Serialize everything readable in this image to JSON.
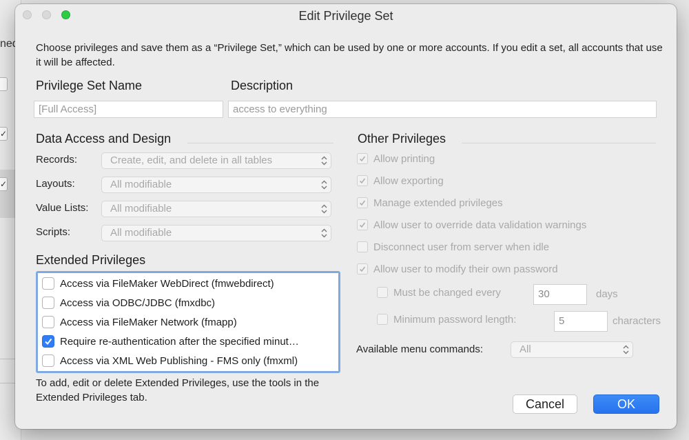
{
  "background": {
    "partial_text": "ned",
    "check_glyph": "✓"
  },
  "dialog": {
    "title": "Edit Privilege Set",
    "intro": "Choose privileges and save them as a “Privilege Set,” which can be used by one or more accounts. If you edit a set, all accounts that use it will be affected.",
    "name_label": "Privilege Set Name",
    "name_value": "[Full Access]",
    "description_label": "Description",
    "description_value": "access to everything"
  },
  "data_access": {
    "heading": "Data Access and Design",
    "rows": [
      {
        "label": "Records:",
        "value": "Create, edit, and delete in all tables"
      },
      {
        "label": "Layouts:",
        "value": "All modifiable"
      },
      {
        "label": "Value Lists:",
        "value": "All modifiable"
      },
      {
        "label": "Scripts:",
        "value": "All modifiable"
      }
    ]
  },
  "extended": {
    "heading": "Extended Privileges",
    "items": [
      {
        "label": "Access via FileMaker WebDirect (fmwebdirect)",
        "checked": false
      },
      {
        "label": "Access via ODBC/JDBC (fmxdbc)",
        "checked": false
      },
      {
        "label": "Access via FileMaker Network (fmapp)",
        "checked": false
      },
      {
        "label": "Require re-authentication after the specified minut…",
        "checked": true
      },
      {
        "label": "Access via XML Web Publishing - FMS only (fmxml)",
        "checked": false
      }
    ],
    "help": "To add, edit or delete Extended Privileges, use the tools in the Extended Privileges tab."
  },
  "other": {
    "heading": "Other Privileges",
    "items": [
      {
        "label": "Allow printing",
        "checked": true
      },
      {
        "label": "Allow exporting",
        "checked": true
      },
      {
        "label": "Manage extended privileges",
        "checked": true
      },
      {
        "label": "Allow user to override data validation warnings",
        "checked": true
      },
      {
        "label": "Disconnect user from server when idle",
        "checked": false
      },
      {
        "label": "Allow user to modify their own password",
        "checked": true
      }
    ],
    "must_change_label": "Must be changed every",
    "must_change_value": "30",
    "must_change_unit": "days",
    "min_length_label": "Minimum password length:",
    "min_length_value": "5",
    "min_length_unit": "characters",
    "menu_label": "Available menu commands:",
    "menu_value": "All"
  },
  "buttons": {
    "cancel": "Cancel",
    "ok": "OK"
  },
  "colors": {
    "accent": "#2f7ef5",
    "focus_ring": "#7fa9e0",
    "zoom_button": "#2ecb44"
  }
}
